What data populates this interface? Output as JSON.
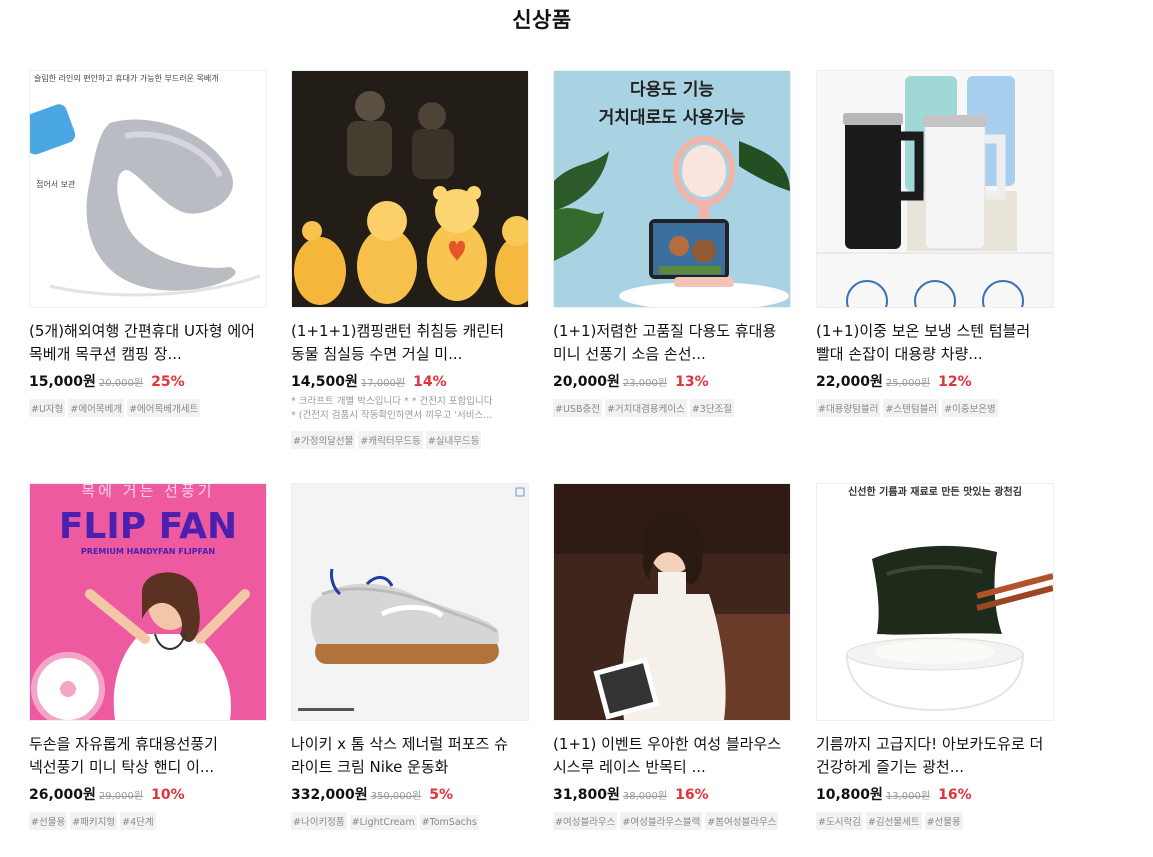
{
  "page": {
    "title": "신상품"
  },
  "products": [
    {
      "name": "(5개)해외여행 간편휴대 U자형 에어 목베개 목쿠션 캠핑 장...",
      "price": "15,000원",
      "original_price": "20,000원",
      "discount": "25%",
      "image_text": {
        "top": "슬림한 라인의 편안하고 휴대가 가능한 부드러운 목베개",
        "side": "접어서 보관"
      },
      "tags": [
        "#U자형",
        "#에어목베개",
        "#에어목베개세트"
      ]
    },
    {
      "name": "(1+1+1)캠핑랜턴 취침등 캐린터 동물 침실등 수면 거실 미...",
      "price": "14,500원",
      "original_price": "17,000원",
      "discount": "14%",
      "description": [
        "* 크라프트 개별 박스입니다 * * 건전지 포함입니다",
        "* (건전지 검품시 작동확인하면서 끼우고 '서비스..."
      ],
      "tags": [
        "#가정의달선물",
        "#캐릭터무드등",
        "#실내무드등"
      ]
    },
    {
      "name": "(1+1)저렴한 고품질 다용도 휴대용 미니 선풍기 소음 손선...",
      "price": "20,000원",
      "original_price": "23,000원",
      "discount": "13%",
      "image_text": {
        "line1": "다용도 기능",
        "line2": "거치대로도 사용가능"
      },
      "tags": [
        "#USB충전",
        "#거치대겸용케이스",
        "#3단조절"
      ]
    },
    {
      "name": "(1+1)이중 보온 보냉 스텐 텀블러 빨대 손잡이 대용량 차량...",
      "price": "22,000원",
      "original_price": "25,000원",
      "discount": "12%",
      "tags": [
        "#대용량텀블러",
        "#스텐텀블러",
        "#이중보온병"
      ]
    },
    {
      "name": "두손을 자유롭게 휴대용선풍기 넥선풍기 미니 탁상 핸디 이...",
      "price": "26,000원",
      "original_price": "29,000원",
      "discount": "10%",
      "image_text": {
        "top": "목에 거는 선풍기",
        "brand": "FLIP FAN",
        "sub": "PREMIUM HANDYFAN FLIPFAN"
      },
      "tags": [
        "#선물용",
        "#패키지형",
        "#4단계"
      ]
    },
    {
      "name": "나이키 x 톰 삭스 제너럴 퍼포즈 슈 라이트 크림 Nike 운동화",
      "price": "332,000원",
      "original_price": "350,000원",
      "discount": "5%",
      "tags": [
        "#나이키정품",
        "#LightCream",
        "#TomSachs"
      ]
    },
    {
      "name": "(1+1) 이벤트 우아한 여성 블라우스 시스루 레이스 반목티 ...",
      "price": "31,800원",
      "original_price": "38,000원",
      "discount": "16%",
      "tags": [
        "#여성블라우스",
        "#여성블라우스블랙",
        "#봄여성블라우스"
      ]
    },
    {
      "name": "기름까지 고급지다! 아보카도유로 더 건강하게 즐기는 광천...",
      "price": "10,800원",
      "original_price": "13,000원",
      "discount": "16%",
      "image_text": {
        "top": "신선한 기름과 재료로 만든 맛있는 광천김"
      },
      "tags": [
        "#도시락김",
        "#김선물세트",
        "#선물용"
      ]
    }
  ]
}
